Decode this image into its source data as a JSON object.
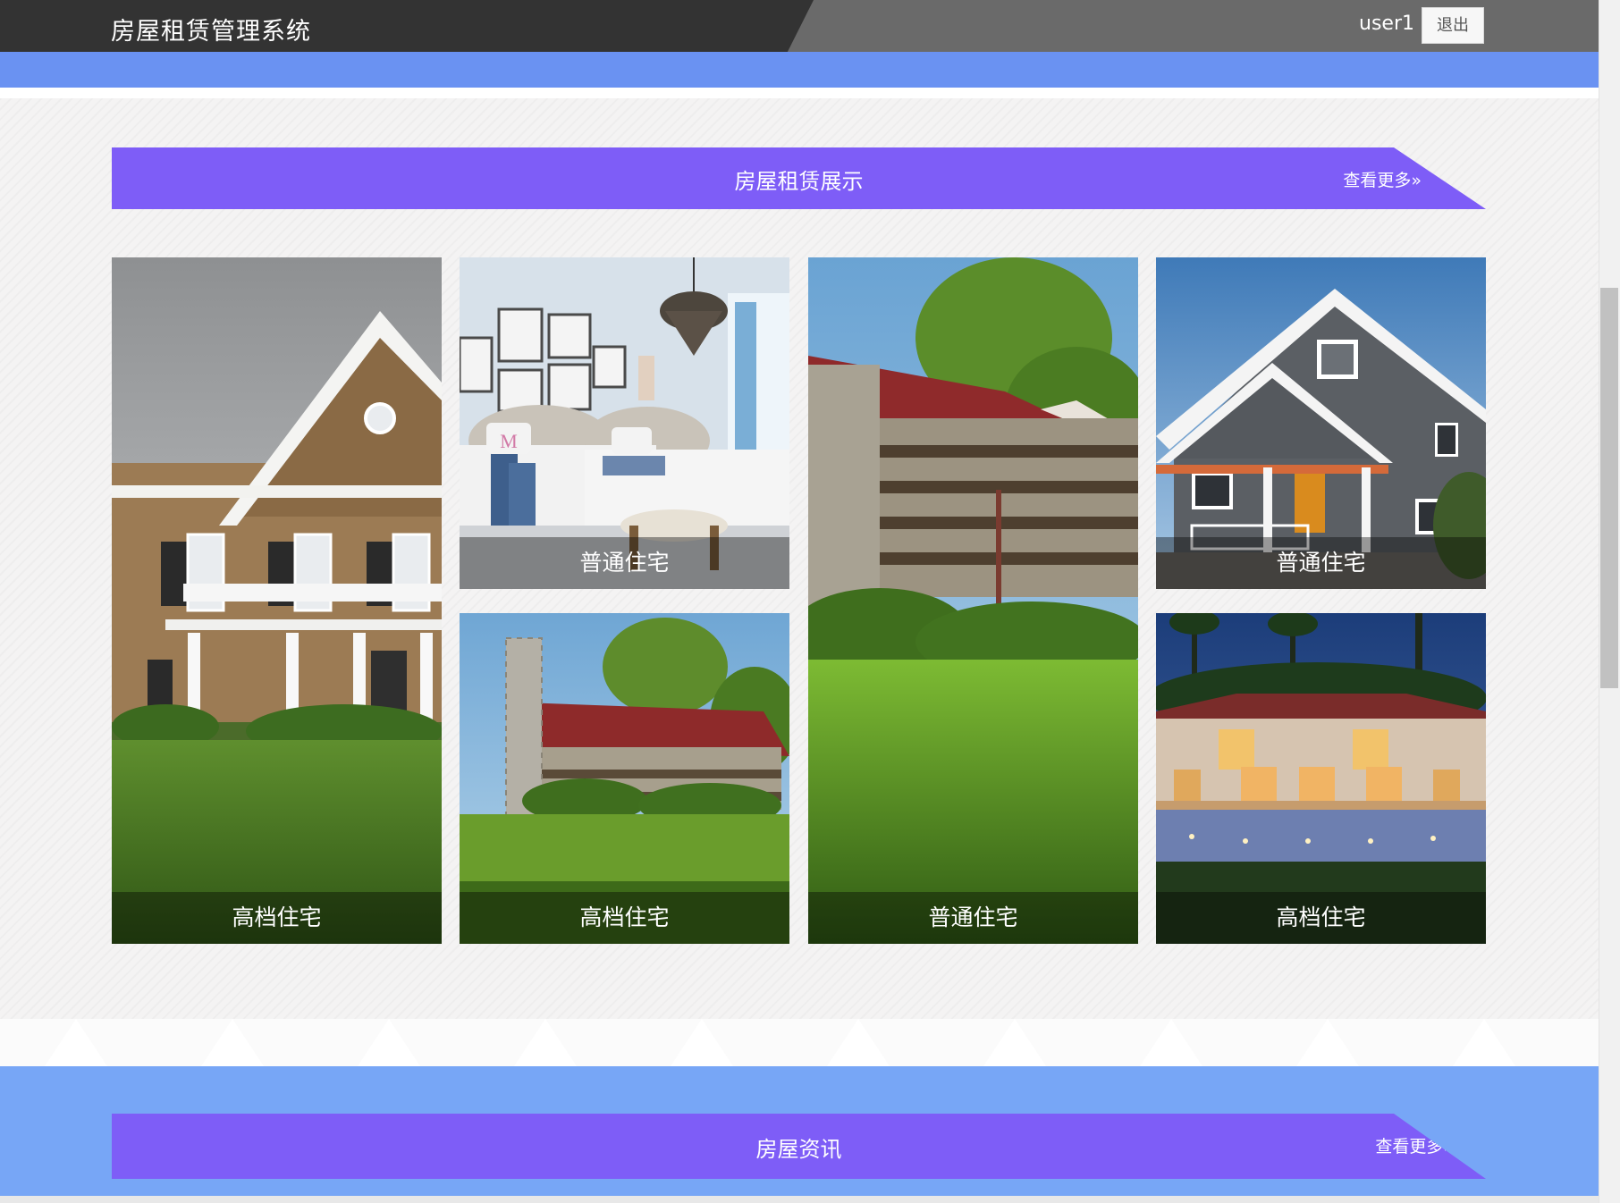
{
  "header": {
    "title": "房屋租赁管理系统",
    "username": "user1",
    "logout_label": "退出"
  },
  "showcase": {
    "title": "房屋租赁展示",
    "more_label": "查看更多»",
    "cards": [
      {
        "caption": "高档住宅",
        "image": "brick-colonial-house"
      },
      {
        "caption": "普通住宅",
        "image": "twin-bedroom-interior"
      },
      {
        "caption": "高档住宅",
        "image": "log-cabin-with-stone-chimney"
      },
      {
        "caption": "普通住宅",
        "image": "log-cabin-on-lawn"
      },
      {
        "caption": "普通住宅",
        "image": "gray-craftsman-house"
      },
      {
        "caption": "高档住宅",
        "image": "mediterranean-villa-at-dusk"
      }
    ]
  },
  "news": {
    "title": "房屋资讯",
    "more_label": "查看更多»"
  },
  "colors": {
    "topbar_dark": "#333333",
    "topbar_gray": "#6a6a6a",
    "accent_blue": "#6a92f2",
    "header_purple": "#7e5df7",
    "news_bg": "#77a6f6"
  }
}
